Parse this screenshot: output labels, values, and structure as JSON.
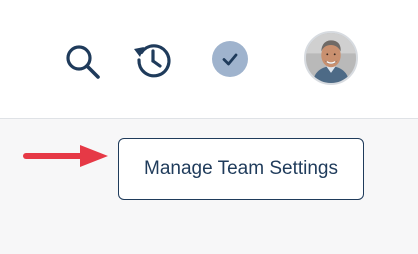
{
  "header": {
    "icons": {
      "search": "search-icon",
      "history": "history-icon",
      "status": "check-icon",
      "profile": "avatar"
    },
    "accent_color": "#1f3b5b",
    "badge_color": "#9fb3cd"
  },
  "main": {
    "manage_button_label": "Manage Team Settings",
    "arrow_color": "#e63946"
  }
}
